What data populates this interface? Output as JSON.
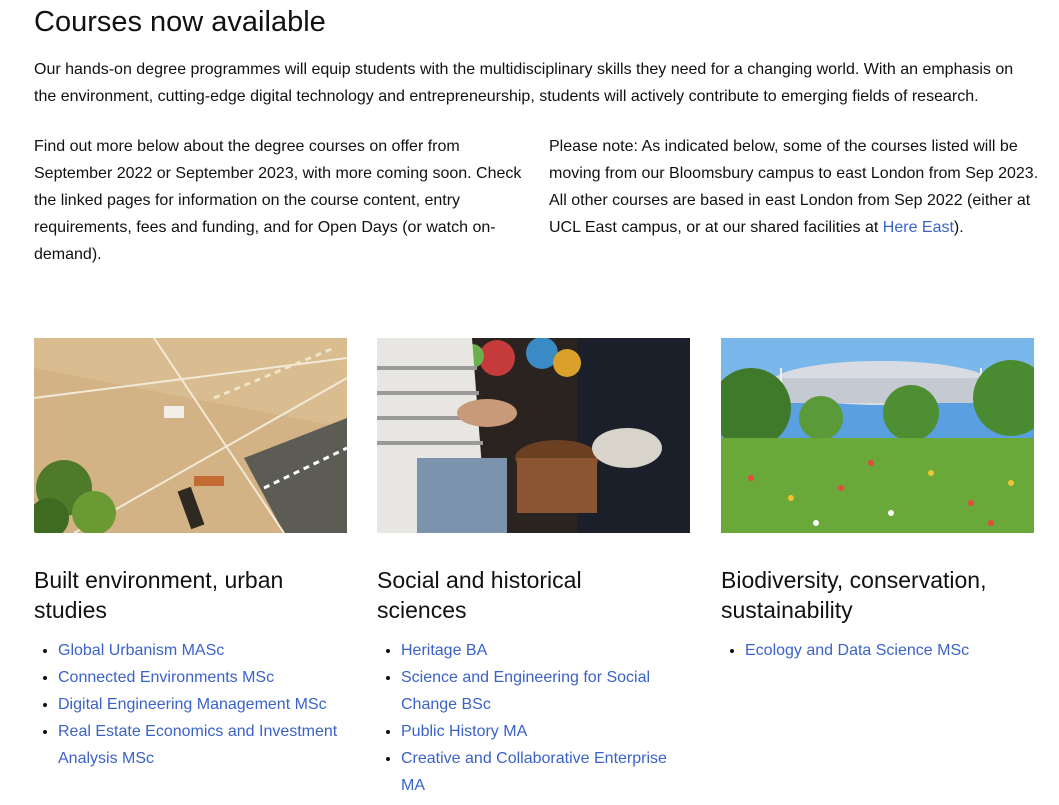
{
  "page": {
    "title": "Courses now available",
    "intro": "Our hands-on degree programmes will equip students with the multidisciplinary skills they need for a changing world. With an emphasis on the environment, cutting-edge digital technology and entrepreneurship, students will actively contribute to emerging fields of research.",
    "left_text": "Find out more below about the degree courses on offer from September 2022 or September 2023, with more coming soon. Check the linked pages for information on the course content, entry requirements, fees and funding, and for Open Days (or watch on-demand).",
    "right_text_before": "Please note: As indicated below, some of the courses listed will be moving from our Bloomsbury campus to east London from Sep 2023. All other courses are based in east London from Sep 2022 (either at UCL East campus, or at our shared facilities at ",
    "right_link": "Here East",
    "right_text_after": ")."
  },
  "categories": [
    {
      "heading": "Built environment, urban studies",
      "links": [
        "Global Urbanism MASc",
        "Connected Environments MSc",
        "Digital Engineering Management MSc",
        "Real Estate Economics and Investment Analysis MSc"
      ]
    },
    {
      "heading": "Social and historical sciences",
      "links": [
        "Heritage BA",
        "Science and Engineering for Social Change BSc",
        "Public History MA",
        "Creative and Collaborative Enterprise MA"
      ]
    },
    {
      "heading": "Biodiversity, conservation, sustainability",
      "links": [
        "Ecology and Data Science MSc"
      ]
    }
  ],
  "colors": {
    "link": "#3a62c9",
    "text": "#111111"
  }
}
